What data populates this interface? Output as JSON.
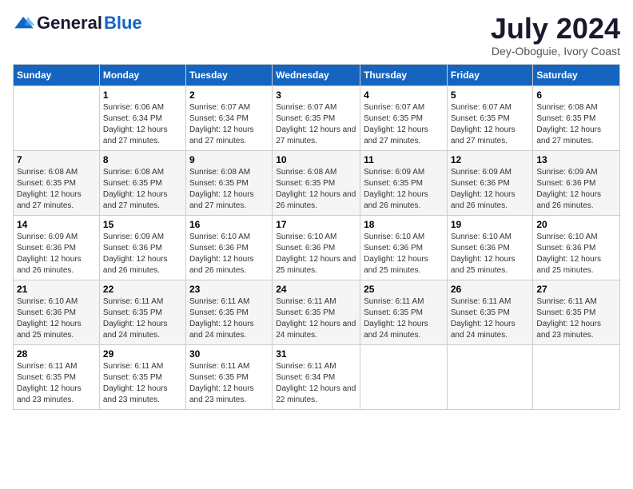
{
  "header": {
    "logo": {
      "general": "General",
      "blue": "Blue"
    },
    "title": "July 2024",
    "location": "Dey-Oboguie, Ivory Coast"
  },
  "calendar": {
    "days_of_week": [
      "Sunday",
      "Monday",
      "Tuesday",
      "Wednesday",
      "Thursday",
      "Friday",
      "Saturday"
    ],
    "weeks": [
      [
        {
          "day": null,
          "content": null
        },
        {
          "day": "1",
          "sunrise": "Sunrise: 6:06 AM",
          "sunset": "Sunset: 6:34 PM",
          "daylight": "Daylight: 12 hours and 27 minutes."
        },
        {
          "day": "2",
          "sunrise": "Sunrise: 6:07 AM",
          "sunset": "Sunset: 6:34 PM",
          "daylight": "Daylight: 12 hours and 27 minutes."
        },
        {
          "day": "3",
          "sunrise": "Sunrise: 6:07 AM",
          "sunset": "Sunset: 6:35 PM",
          "daylight": "Daylight: 12 hours and 27 minutes."
        },
        {
          "day": "4",
          "sunrise": "Sunrise: 6:07 AM",
          "sunset": "Sunset: 6:35 PM",
          "daylight": "Daylight: 12 hours and 27 minutes."
        },
        {
          "day": "5",
          "sunrise": "Sunrise: 6:07 AM",
          "sunset": "Sunset: 6:35 PM",
          "daylight": "Daylight: 12 hours and 27 minutes."
        },
        {
          "day": "6",
          "sunrise": "Sunrise: 6:08 AM",
          "sunset": "Sunset: 6:35 PM",
          "daylight": "Daylight: 12 hours and 27 minutes."
        }
      ],
      [
        {
          "day": "7",
          "sunrise": "Sunrise: 6:08 AM",
          "sunset": "Sunset: 6:35 PM",
          "daylight": "Daylight: 12 hours and 27 minutes."
        },
        {
          "day": "8",
          "sunrise": "Sunrise: 6:08 AM",
          "sunset": "Sunset: 6:35 PM",
          "daylight": "Daylight: 12 hours and 27 minutes."
        },
        {
          "day": "9",
          "sunrise": "Sunrise: 6:08 AM",
          "sunset": "Sunset: 6:35 PM",
          "daylight": "Daylight: 12 hours and 27 minutes."
        },
        {
          "day": "10",
          "sunrise": "Sunrise: 6:08 AM",
          "sunset": "Sunset: 6:35 PM",
          "daylight": "Daylight: 12 hours and 26 minutes."
        },
        {
          "day": "11",
          "sunrise": "Sunrise: 6:09 AM",
          "sunset": "Sunset: 6:35 PM",
          "daylight": "Daylight: 12 hours and 26 minutes."
        },
        {
          "day": "12",
          "sunrise": "Sunrise: 6:09 AM",
          "sunset": "Sunset: 6:36 PM",
          "daylight": "Daylight: 12 hours and 26 minutes."
        },
        {
          "day": "13",
          "sunrise": "Sunrise: 6:09 AM",
          "sunset": "Sunset: 6:36 PM",
          "daylight": "Daylight: 12 hours and 26 minutes."
        }
      ],
      [
        {
          "day": "14",
          "sunrise": "Sunrise: 6:09 AM",
          "sunset": "Sunset: 6:36 PM",
          "daylight": "Daylight: 12 hours and 26 minutes."
        },
        {
          "day": "15",
          "sunrise": "Sunrise: 6:09 AM",
          "sunset": "Sunset: 6:36 PM",
          "daylight": "Daylight: 12 hours and 26 minutes."
        },
        {
          "day": "16",
          "sunrise": "Sunrise: 6:10 AM",
          "sunset": "Sunset: 6:36 PM",
          "daylight": "Daylight: 12 hours and 26 minutes."
        },
        {
          "day": "17",
          "sunrise": "Sunrise: 6:10 AM",
          "sunset": "Sunset: 6:36 PM",
          "daylight": "Daylight: 12 hours and 25 minutes."
        },
        {
          "day": "18",
          "sunrise": "Sunrise: 6:10 AM",
          "sunset": "Sunset: 6:36 PM",
          "daylight": "Daylight: 12 hours and 25 minutes."
        },
        {
          "day": "19",
          "sunrise": "Sunrise: 6:10 AM",
          "sunset": "Sunset: 6:36 PM",
          "daylight": "Daylight: 12 hours and 25 minutes."
        },
        {
          "day": "20",
          "sunrise": "Sunrise: 6:10 AM",
          "sunset": "Sunset: 6:36 PM",
          "daylight": "Daylight: 12 hours and 25 minutes."
        }
      ],
      [
        {
          "day": "21",
          "sunrise": "Sunrise: 6:10 AM",
          "sunset": "Sunset: 6:36 PM",
          "daylight": "Daylight: 12 hours and 25 minutes."
        },
        {
          "day": "22",
          "sunrise": "Sunrise: 6:11 AM",
          "sunset": "Sunset: 6:35 PM",
          "daylight": "Daylight: 12 hours and 24 minutes."
        },
        {
          "day": "23",
          "sunrise": "Sunrise: 6:11 AM",
          "sunset": "Sunset: 6:35 PM",
          "daylight": "Daylight: 12 hours and 24 minutes."
        },
        {
          "day": "24",
          "sunrise": "Sunrise: 6:11 AM",
          "sunset": "Sunset: 6:35 PM",
          "daylight": "Daylight: 12 hours and 24 minutes."
        },
        {
          "day": "25",
          "sunrise": "Sunrise: 6:11 AM",
          "sunset": "Sunset: 6:35 PM",
          "daylight": "Daylight: 12 hours and 24 minutes."
        },
        {
          "day": "26",
          "sunrise": "Sunrise: 6:11 AM",
          "sunset": "Sunset: 6:35 PM",
          "daylight": "Daylight: 12 hours and 24 minutes."
        },
        {
          "day": "27",
          "sunrise": "Sunrise: 6:11 AM",
          "sunset": "Sunset: 6:35 PM",
          "daylight": "Daylight: 12 hours and 23 minutes."
        }
      ],
      [
        {
          "day": "28",
          "sunrise": "Sunrise: 6:11 AM",
          "sunset": "Sunset: 6:35 PM",
          "daylight": "Daylight: 12 hours and 23 minutes."
        },
        {
          "day": "29",
          "sunrise": "Sunrise: 6:11 AM",
          "sunset": "Sunset: 6:35 PM",
          "daylight": "Daylight: 12 hours and 23 minutes."
        },
        {
          "day": "30",
          "sunrise": "Sunrise: 6:11 AM",
          "sunset": "Sunset: 6:35 PM",
          "daylight": "Daylight: 12 hours and 23 minutes."
        },
        {
          "day": "31",
          "sunrise": "Sunrise: 6:11 AM",
          "sunset": "Sunset: 6:34 PM",
          "daylight": "Daylight: 12 hours and 22 minutes."
        },
        {
          "day": null,
          "content": null
        },
        {
          "day": null,
          "content": null
        },
        {
          "day": null,
          "content": null
        }
      ]
    ]
  }
}
